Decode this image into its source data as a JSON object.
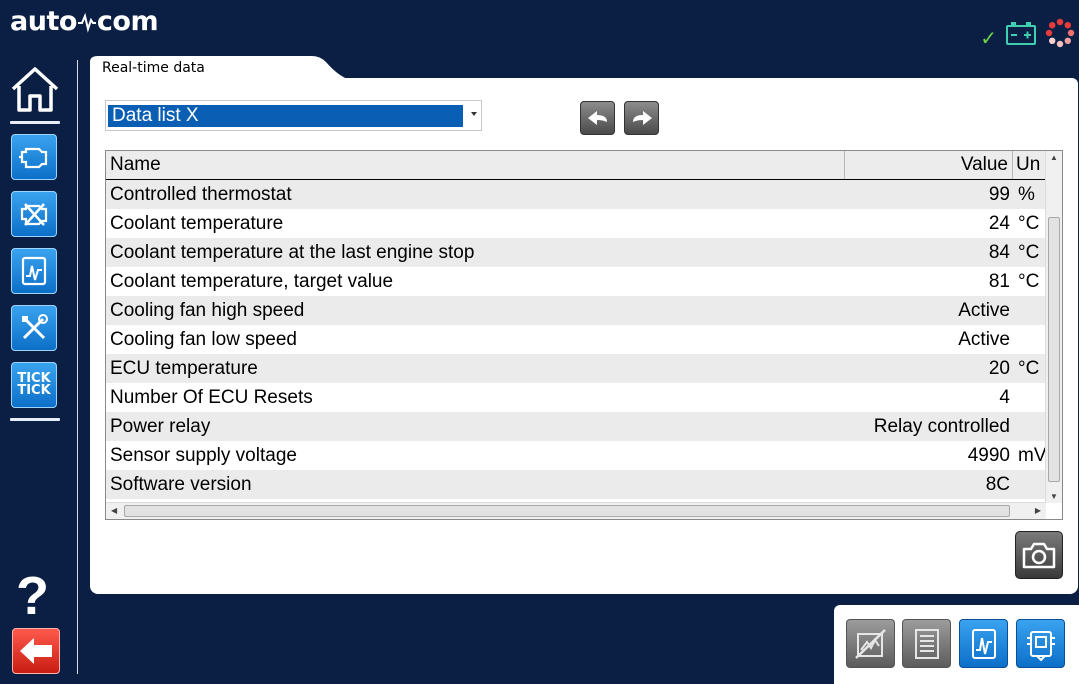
{
  "app": {
    "logo_left": "auto",
    "logo_right": "com"
  },
  "tab": {
    "label": "Real-time data"
  },
  "data_list": {
    "selected": "Data list X"
  },
  "table": {
    "columns": [
      "Name",
      "Value",
      "Un"
    ],
    "rows": [
      {
        "name": "Controlled thermostat",
        "value": "99",
        "unit": "%"
      },
      {
        "name": "Coolant temperature",
        "value": "24",
        "unit": "°C"
      },
      {
        "name": "Coolant temperature at the last engine stop",
        "value": "84",
        "unit": "°C"
      },
      {
        "name": "Coolant temperature, target value",
        "value": "81",
        "unit": "°C"
      },
      {
        "name": "Cooling fan high speed",
        "value": "Active",
        "unit": ""
      },
      {
        "name": "Cooling fan low speed",
        "value": "Active",
        "unit": ""
      },
      {
        "name": "ECU temperature",
        "value": "20",
        "unit": "°C"
      },
      {
        "name": "Number Of ECU Resets",
        "value": "4",
        "unit": ""
      },
      {
        "name": "Power relay",
        "value": "Relay controlled",
        "unit": ""
      },
      {
        "name": "Sensor supply voltage",
        "value": "4990",
        "unit": "mV"
      },
      {
        "name": "Software version",
        "value": "8C",
        "unit": ""
      }
    ]
  },
  "sidebar": {
    "tick_line1": "TICK",
    "tick_line2": "TICK",
    "help": "?"
  },
  "colors": {
    "background": "#0b1f45",
    "accent_blue": "#0c6fc9",
    "selection": "#0a5fb4",
    "back_red": "#c81d12",
    "ok_green": "#6cd54a"
  }
}
